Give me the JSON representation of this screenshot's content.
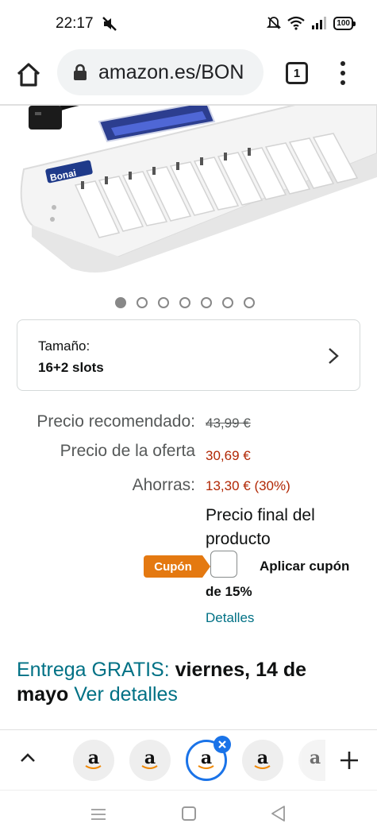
{
  "status_bar": {
    "time": "22:17",
    "battery": "100",
    "icons": [
      "mute-icon",
      "alarm-off-icon",
      "wifi-icon",
      "signal-icon",
      "battery-icon"
    ]
  },
  "browser": {
    "url": "amazon.es/BON",
    "tab_count": "1",
    "icons": [
      "home-icon",
      "lock-icon",
      "overflow-menu-icon"
    ]
  },
  "product": {
    "brand_on_image": "Bonai",
    "carousel": {
      "total": 7,
      "active_index": 0
    }
  },
  "size_selector": {
    "label": "Tamaño:",
    "value": "16+2 slots"
  },
  "pricing": {
    "list_price_label": "Precio recomendado:",
    "list_price": "43,99 €",
    "deal_price_label": "Precio de la oferta",
    "deal_price": "30,69 €",
    "savings_label": "Ahorras:",
    "savings": "13,30 € (30%)",
    "final_price_note": "Precio final del producto"
  },
  "coupon": {
    "badge": "Cupón",
    "apply_text_line1": "Aplicar cupón",
    "apply_text_line2": "de 15%",
    "details_link": "Detalles",
    "checked": false
  },
  "delivery": {
    "prefix": "Entrega GRATIS:",
    "date": "viernes, 14 de mayo",
    "link": "Ver detalles"
  },
  "tab_strip": {
    "tabs": [
      {
        "logo": "a",
        "active": false
      },
      {
        "logo": "a",
        "active": false
      },
      {
        "logo": "a",
        "active": true
      },
      {
        "logo": "a",
        "active": false
      },
      {
        "logo": "a",
        "active": false
      }
    ]
  },
  "colors": {
    "price_red": "#b12704",
    "link_teal": "#007185",
    "coupon_orange": "#e47911",
    "active_tab_blue": "#1a73e8"
  }
}
